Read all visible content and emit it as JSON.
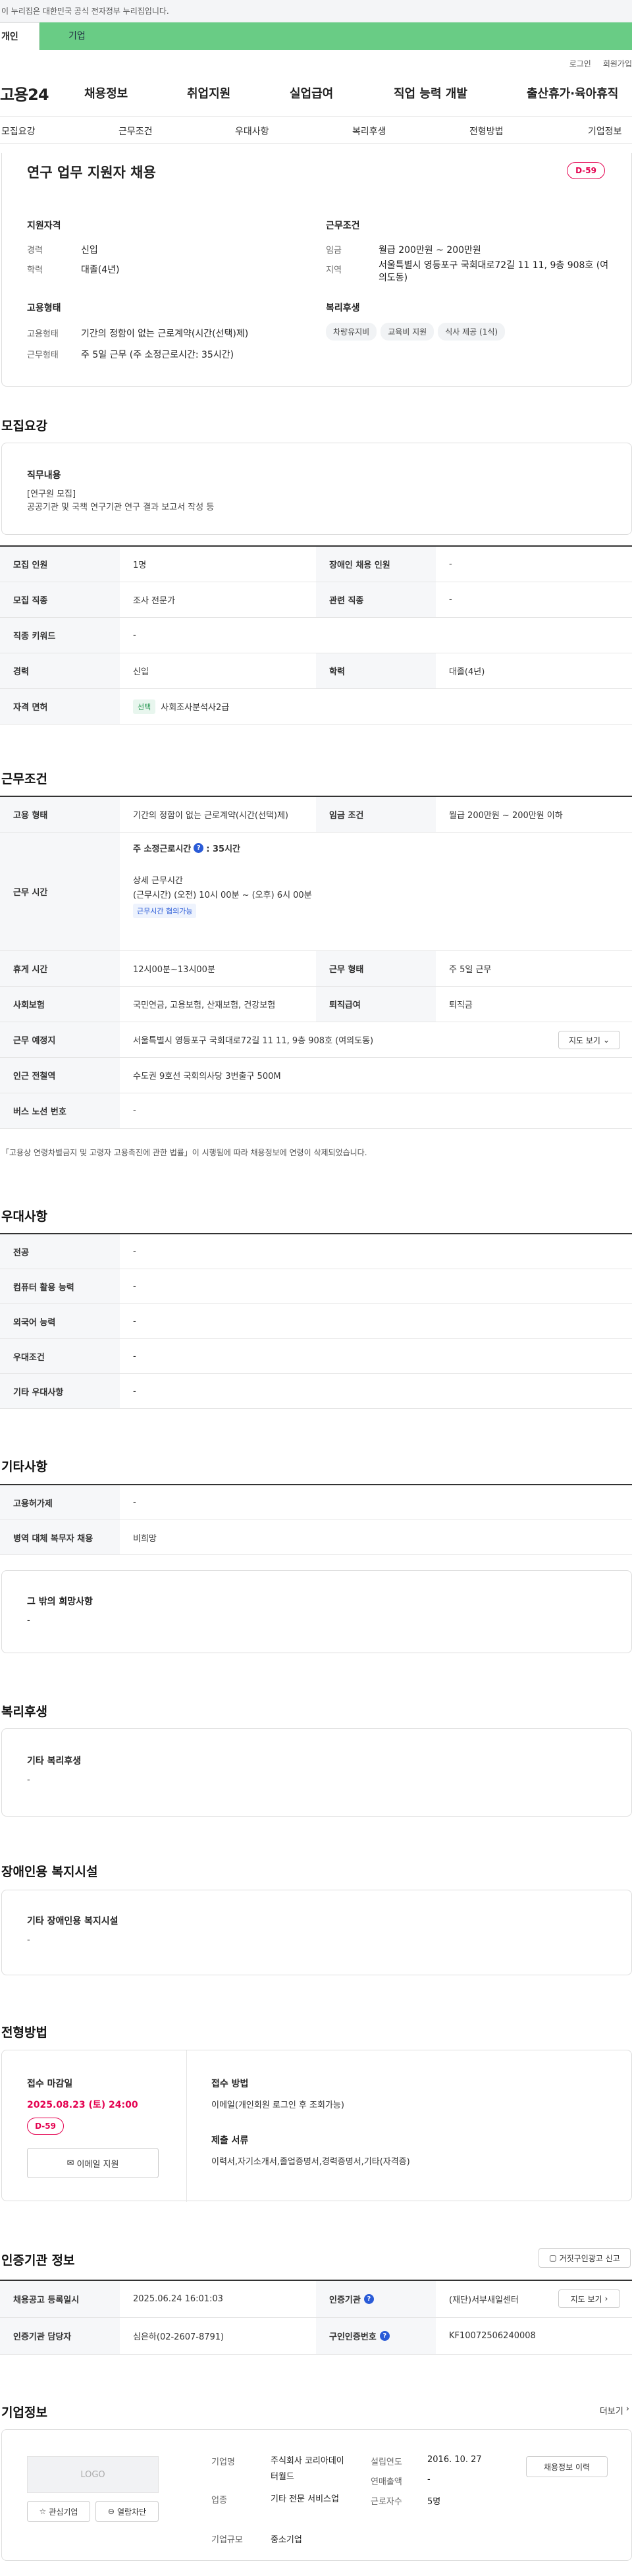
{
  "gov_banner": "이 누리집은 대한민국 공식 전자정부 누리집입니다.",
  "tabs": {
    "personal": "개인",
    "company": "기업"
  },
  "util": {
    "login": "로그인",
    "join": "회원가입"
  },
  "gnb": {
    "logo": "고용24",
    "menu": [
      "채용정보",
      "취업지원",
      "실업급여",
      "직업 능력 개발",
      "출산휴가·육아휴직"
    ]
  },
  "secnav": [
    "모집요강",
    "근무조건",
    "우대사항",
    "복리후생",
    "전형방법",
    "기업정보"
  ],
  "summary": {
    "title": "연구 업무 지원자 채용",
    "dday": "D-59",
    "qual_title": "지원자격",
    "career_label": "경력",
    "career": "신입",
    "edu_label": "학력",
    "edu": "대졸(4년)",
    "cond_title": "근무조건",
    "wage_label": "임금",
    "wage": "월급 200만원 ~ 200만원",
    "region_label": "지역",
    "region": "서울특별시 영등포구 국회대로72길 11 11, 9층 908호 (여의도동)",
    "emp_title": "고용형태",
    "emptype_label": "고용형태",
    "emptype": "기간의 정함이 없는 근로계약(시간(선택)제)",
    "worktype_label": "근무형태",
    "worktype": "주 5일 근무 (주 소정근로시간: 35시간)",
    "welfare_title": "복리후생",
    "welfare": [
      "차량유지비",
      "교육비 지원",
      "식사 제공 (1식)"
    ]
  },
  "recruit": {
    "heading": "모집요강",
    "duty_title": "직무내용",
    "duty_lines": [
      "[연구원 모집]",
      "공공기관 및 국책 연구기관 연구 결과 보고서 작성 등"
    ],
    "rows": [
      [
        "모집 인원",
        "1명",
        "장애인 채용 인원",
        "-"
      ],
      [
        "모집 직종",
        "조사 전문가",
        "관련 직종",
        "-"
      ],
      [
        "직종 키워드",
        "-"
      ],
      [
        "경력",
        "신입",
        "학력",
        "대졸(4년)"
      ]
    ],
    "license_label": "자격 면허",
    "license_tag": "선택",
    "license": "사회조사분석사2급"
  },
  "conditions": {
    "heading": "근무조건",
    "emptype_label": "고용 형태",
    "emptype": "기간의 정함이 없는 근로계약(시간(선택)제)",
    "wage_label": "임금 조건",
    "wage": "월급 200만원 ~ 200만원 이하",
    "worktime_label": "근무 시간",
    "weekly": "주 소정근로시간",
    "weekly_val": ": 35시간",
    "detail_title": "상세 근무시간",
    "detail": "(근무시간) (오전) 10시 00분 ~ (오후) 6시 00분",
    "negotiable": "근무시간 협의가능",
    "rest_label": "휴게 시간",
    "rest": "12시00분~13시00분",
    "form_label": "근무 형태",
    "form": "주 5일 근무",
    "ins_label": "사회보험",
    "ins": "국민연금, 고용보험, 산재보험, 건강보험",
    "sev_label": "퇴직급여",
    "sev": "퇴직금",
    "place_label": "근무 예정지",
    "place": "서울특별시 영등포구 국회대로72길 11 11, 9층 908호 (여의도동)",
    "map_btn": "지도 보기",
    "station_label": "인근 전철역",
    "station": "수도권 9호선 국회의사당 3번출구 500M",
    "bus_label": "버스 노선 번호",
    "bus": "-",
    "note": "「고용상 연령차별금지 및 고령자 고용촉진에 관한 법률」이 시행됨에 따라 채용정보에 연령이 삭제되었습니다."
  },
  "pref": {
    "heading": "우대사항",
    "rows": [
      [
        "전공",
        "-"
      ],
      [
        "컴퓨터 활용 능력",
        "-"
      ],
      [
        "외국어 능력",
        "-"
      ],
      [
        "우대조건",
        "-"
      ],
      [
        "기타 우대사항",
        "-"
      ]
    ]
  },
  "etc": {
    "heading": "기타사항",
    "rows": [
      [
        "고용허가제",
        "-"
      ],
      [
        "병역 대체 복무자 채용",
        "비희망"
      ]
    ],
    "wish_title": "그 밖의 희망사항",
    "wish": "-"
  },
  "welfare": {
    "heading": "복리후생",
    "title": "기타 복리후생",
    "value": "-"
  },
  "disability": {
    "heading": "장애인용 복지시설",
    "title": "기타 장애인용 복지시설",
    "value": "-"
  },
  "process": {
    "heading": "전형방법",
    "deadline_title": "접수 마감일",
    "deadline": "2025.08.23 (토) 24:00",
    "dday": "D-59",
    "email_btn": "이메일 지원",
    "method_title": "접수 방법",
    "method": "이메일(개인회원 로그인 후 조회가능)",
    "docs_title": "제출 서류",
    "docs": "이력서,자기소개서,졸업증명서,경력증명서,기타(자격증)"
  },
  "cert": {
    "heading": "인증기관 정보",
    "report_btn": "거짓구인광고 신고",
    "reg_label": "채용공고 등록일시",
    "reg": "2025.06.24 16:01:03",
    "org_label": "인증기관",
    "org": "(재단)서부새일센터",
    "map_btn": "지도 보기",
    "mgr_label": "인증기관 담당자",
    "mgr": "심은하(02-2607-8791)",
    "no_label": "구인인증번호",
    "no": "KF10072506240008"
  },
  "company": {
    "heading": "기업정보",
    "more": "더보기",
    "logo": "LOGO",
    "fav_btn": "관심기업",
    "block_btn": "열람차단",
    "name_label": "기업명",
    "name": "주식회사 코리아데이터월드",
    "industry_label": "업종",
    "industry": "기타 전문 서비스업",
    "size_label": "기업규모",
    "size": "중소기업",
    "founded_label": "설립연도",
    "founded": "2016. 10. 27",
    "sales_label": "연매출액",
    "sales": "-",
    "emp_label": "근로자수",
    "emp": "5명",
    "hist_btn": "채용정보 이력"
  }
}
